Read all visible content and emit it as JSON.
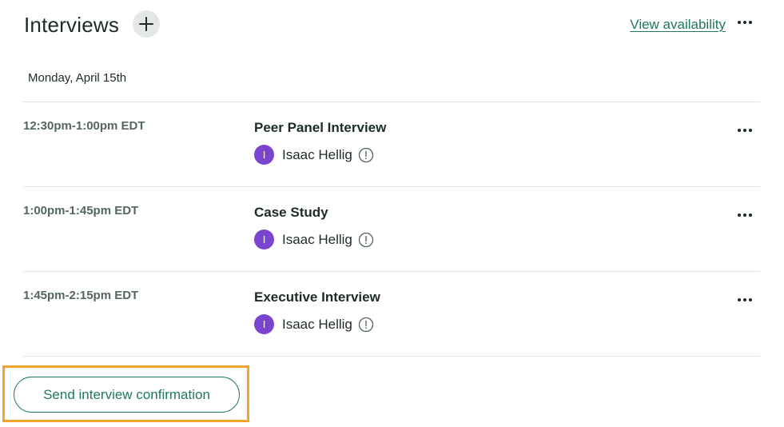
{
  "header": {
    "title": "Interviews",
    "add_icon": "plus-icon",
    "view_availability_label": "View availability",
    "more_icon": "more-horizontal-icon"
  },
  "date_heading": "Monday, April 15th",
  "interviews": [
    {
      "time": "12:30pm-1:00pm EDT",
      "title": "Peer Panel Interview",
      "interviewer": "Isaac Hellig",
      "initial": "I"
    },
    {
      "time": "1:00pm-1:45pm EDT",
      "title": "Case Study",
      "interviewer": "Isaac Hellig",
      "initial": "I"
    },
    {
      "time": "1:45pm-2:15pm EDT",
      "title": "Executive Interview",
      "interviewer": "Isaac Hellig",
      "initial": "I"
    }
  ],
  "actions": {
    "send_confirmation_label": "Send interview confirmation"
  },
  "colors": {
    "accent_green": "#1f7a57",
    "avatar_purple": "#7b44cf",
    "highlight_orange": "#f5a32c",
    "text_dark": "#1d2b27",
    "text_muted": "#55655f"
  }
}
